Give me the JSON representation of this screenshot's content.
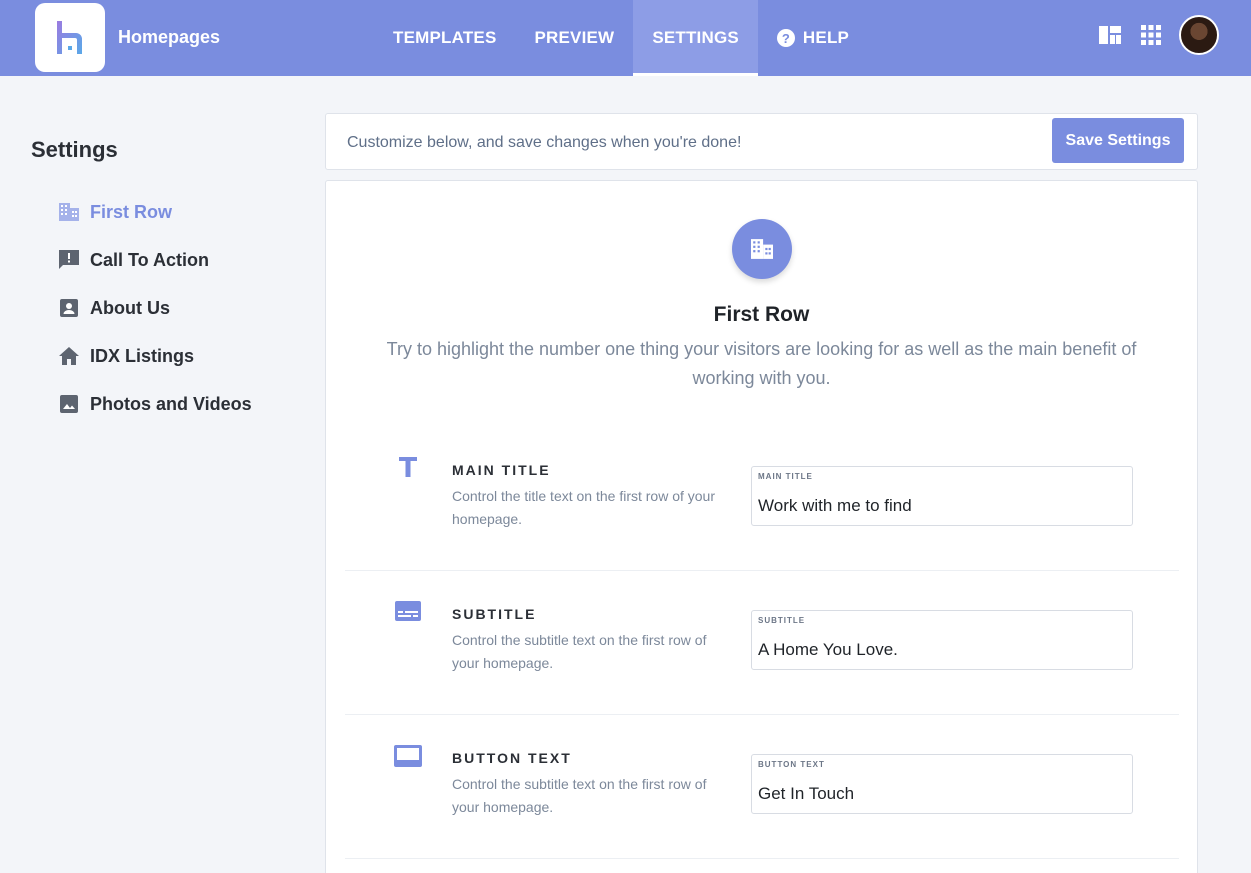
{
  "app": {
    "name": "Homepages"
  },
  "nav": {
    "items": [
      {
        "label": "TEMPLATES"
      },
      {
        "label": "PREVIEW"
      },
      {
        "label": "SETTINGS"
      },
      {
        "label": "HELP"
      }
    ],
    "active": "SETTINGS"
  },
  "sidebar": {
    "title": "Settings",
    "items": [
      {
        "label": "First Row",
        "icon": "building-icon",
        "active": true
      },
      {
        "label": "Call To Action",
        "icon": "feedback-icon"
      },
      {
        "label": "About Us",
        "icon": "person-box-icon"
      },
      {
        "label": "IDX Listings",
        "icon": "home-icon"
      },
      {
        "label": "Photos and Videos",
        "icon": "image-icon"
      }
    ]
  },
  "savebar": {
    "message": "Customize below, and save changes when you're done!",
    "button": "Save Settings"
  },
  "section": {
    "title": "First Row",
    "description": "Try to highlight the number one thing your visitors are looking for as well as the main benefit of working with you.",
    "rows": [
      {
        "title": "MAIN TITLE",
        "description": "Control the title text on the first row of your homepage.",
        "field_label": "MAIN TITLE",
        "value": "Work with me to find",
        "icon": "text-icon"
      },
      {
        "title": "SUBTITLE",
        "description": "Control the subtitle text on the first row of your homepage.",
        "field_label": "SUBTITLE",
        "value": "A Home You Love.",
        "icon": "subtitles-icon"
      },
      {
        "title": "BUTTON TEXT",
        "description": "Control the subtitle text on the first row of your homepage.",
        "field_label": "BUTTON TEXT",
        "value": "Get In Touch",
        "icon": "button-icon"
      }
    ]
  },
  "colors": {
    "accent": "#7a8ddf",
    "text_muted": "#7c889a"
  }
}
